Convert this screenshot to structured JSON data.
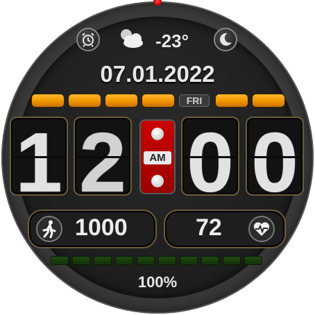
{
  "colors": {
    "accent_orange": "#f5a000",
    "ampm_red": "#c00000",
    "battery_green": "#1f4a12",
    "digit_white": "#e2e2e2"
  },
  "top_row": {
    "alarm_icon": "alarm-clock-icon",
    "weather_icon": "partly-cloudy-icon",
    "temperature": "-23°",
    "night_icon": "moon-icon"
  },
  "date": "07.01.2022",
  "day_of_week": "FRI",
  "time": {
    "hour_tens": "1",
    "hour_ones": "2",
    "minute_tens": "0",
    "minute_ones": "0",
    "ampm": "AM"
  },
  "steps": {
    "icon": "walking-person-icon",
    "value": "1000"
  },
  "heart_rate": {
    "icon": "heart-pulse-icon",
    "value": "72"
  },
  "battery": {
    "percent_text": "100%",
    "level": 1.0,
    "segments": 10
  }
}
